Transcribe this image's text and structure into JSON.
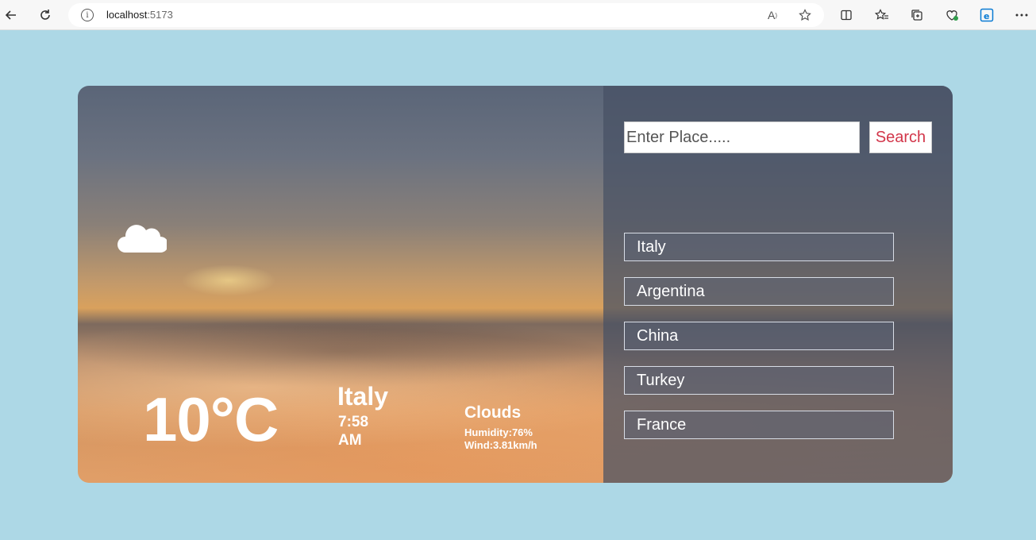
{
  "browser": {
    "url_host": "localhost",
    "url_port": ":5173",
    "icons": [
      "back-icon",
      "refresh-icon",
      "info-icon",
      "read-aloud-icon",
      "favorite-icon",
      "split-screen-icon",
      "favorites-icon",
      "collections-icon",
      "browser-essentials-icon",
      "edge-icon",
      "more-icon"
    ]
  },
  "weather": {
    "icon": "cloud-icon",
    "temperature": "10°C",
    "city": "Italy",
    "time": "7:58 AM",
    "condition": "Clouds",
    "humidity": "Humidity:76%",
    "wind": "Wind:3.81km/h"
  },
  "search": {
    "placeholder": "Enter Place.....",
    "button_label": "Search"
  },
  "countries": [
    "Italy",
    "Argentina",
    "China",
    "Turkey",
    "France"
  ],
  "colors": {
    "page_background": "#add8e6",
    "search_button_text": "#d2364a",
    "text": "#ffffff"
  }
}
